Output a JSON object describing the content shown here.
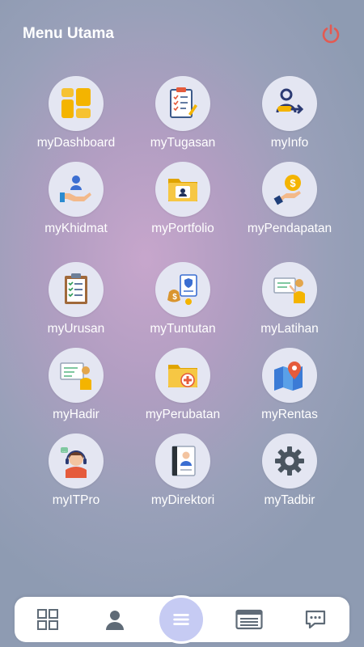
{
  "header": {
    "title": "Menu Utama",
    "power_icon": "power-icon",
    "power_color": "#e35a52"
  },
  "menu": {
    "items": [
      {
        "label": "myDashboard",
        "icon": "dashboard-tiles-icon"
      },
      {
        "label": "myTugasan",
        "icon": "clipboard-checklist-icon"
      },
      {
        "label": "myInfo",
        "icon": "user-switch-icon"
      },
      {
        "label": "myKhidmat",
        "icon": "hand-service-icon"
      },
      {
        "label": "myPortfolio",
        "icon": "folder-profile-icon"
      },
      {
        "label": "myPendapatan",
        "icon": "coin-hand-icon"
      },
      {
        "label": "myUrusan",
        "icon": "clipboard-list-icon"
      },
      {
        "label": "myTuntutan",
        "icon": "money-claim-icon"
      },
      {
        "label": "myLatihan",
        "icon": "training-board-icon"
      },
      {
        "label": "myHadir",
        "icon": "attendance-board-icon"
      },
      {
        "label": "myPerubatan",
        "icon": "medical-folder-icon"
      },
      {
        "label": "myRentas",
        "icon": "map-pin-icon"
      },
      {
        "label": "myITPro",
        "icon": "support-agent-icon"
      },
      {
        "label": "myDirektori",
        "icon": "contact-directory-icon"
      },
      {
        "label": "myTadbir",
        "icon": "gear-icon"
      }
    ]
  },
  "bottom_nav": {
    "items": [
      {
        "icon": "grid-icon"
      },
      {
        "icon": "user-icon"
      },
      {
        "icon": "menu-icon",
        "active": true
      },
      {
        "icon": "id-card-icon"
      },
      {
        "icon": "chat-icon"
      }
    ],
    "accent": "#c6cbf3",
    "icon_color": "#5f6b77"
  }
}
